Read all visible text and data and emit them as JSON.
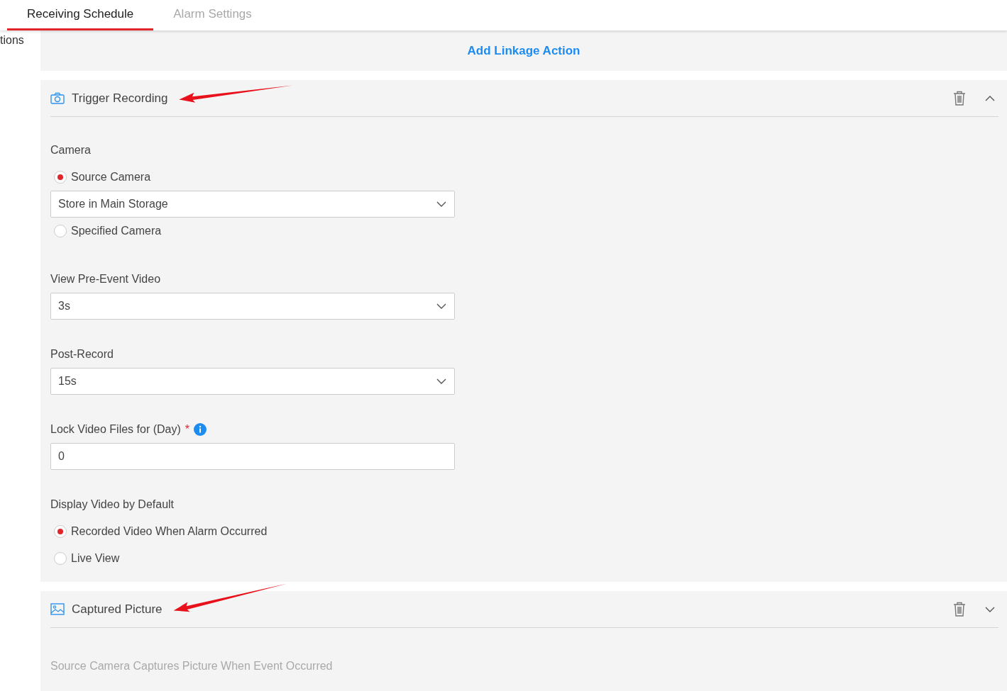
{
  "tabs": [
    {
      "label": "Receiving Schedule",
      "selected": true
    },
    {
      "label": "Alarm Settings",
      "selected": false
    }
  ],
  "side_text": "tions",
  "add_action": "Add Linkage Action",
  "sections": [
    {
      "kind": "camera",
      "title": "Trigger Recording",
      "expanded": true,
      "callout_arrow": true,
      "groups": [
        {
          "label": "Camera",
          "items": [
            {
              "kind": "radio",
              "label": "Source Camera",
              "selected": true
            },
            {
              "kind": "select",
              "value": "Store in Main Storage"
            },
            {
              "kind": "radio",
              "label": "Specified Camera",
              "selected": false
            }
          ]
        },
        {
          "label": "View Pre-Event Video",
          "items": [
            {
              "kind": "select",
              "value": "3s"
            }
          ]
        },
        {
          "label": "Post-Record",
          "items": [
            {
              "kind": "select",
              "value": "15s"
            }
          ]
        },
        {
          "label": "Lock Video Files for (Day)",
          "required_mark": "*",
          "info": true,
          "items": [
            {
              "kind": "input",
              "value": "0"
            }
          ]
        },
        {
          "label": "Display Video by Default",
          "items": [
            {
              "kind": "radio",
              "label": "Recorded Video When Alarm Occurred",
              "selected": true
            },
            {
              "kind": "radio",
              "label": "Live View",
              "selected": false
            }
          ]
        }
      ]
    },
    {
      "kind": "picture",
      "title": "Captured Picture",
      "expanded": false,
      "callout_arrow": true,
      "note": "Source Camera Captures Picture When Event Occurred"
    }
  ]
}
